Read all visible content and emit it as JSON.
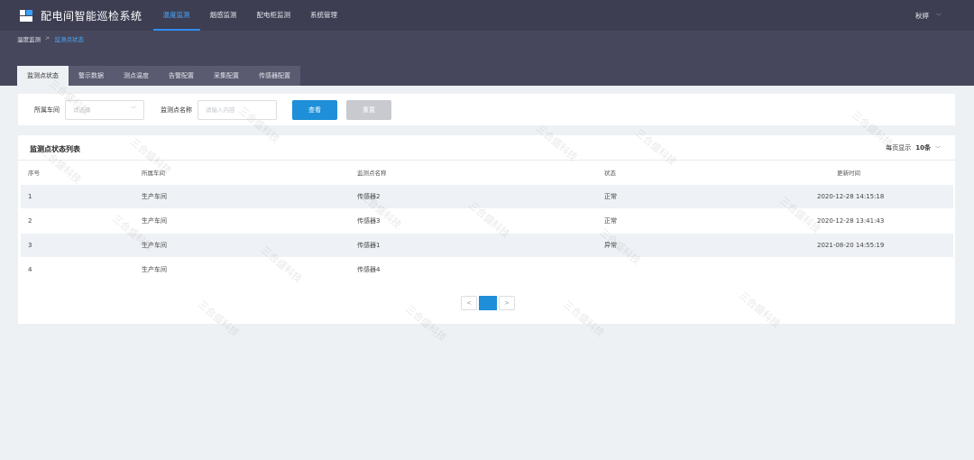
{
  "app": {
    "title": "配电间智能巡检系统",
    "user": "秋婷"
  },
  "nav": [
    {
      "label": "温度监测",
      "active": true
    },
    {
      "label": "烟感监测",
      "active": false
    },
    {
      "label": "配电柜监测",
      "active": false
    },
    {
      "label": "系统管理",
      "active": false
    }
  ],
  "breadcrumb": {
    "root": "温度监测",
    "separator": ">",
    "current": "监测点状态"
  },
  "tabs": [
    "监测点状态",
    "警示数据",
    "测点温度",
    "告警配置",
    "采集配置",
    "传感器配置"
  ],
  "filter": {
    "workshop_label": "所属车间",
    "workshop_placeholder": "请选择",
    "point_label": "监测点名称",
    "point_placeholder": "请输入内容",
    "search_button": "查看",
    "reset_button": "重置"
  },
  "table": {
    "title": "监测点状态列表",
    "page_size_label": "每页显示",
    "page_size_value": "10条",
    "columns": [
      "序号",
      "所属车间",
      "监测点名称",
      "状态",
      "更新时间"
    ],
    "rows": [
      [
        "1",
        "生产车间",
        "传感器2",
        "正常",
        "2020-12-28 14:15:18"
      ],
      [
        "2",
        "生产车间",
        "传感器3",
        "正常",
        "2020-12-28 13:41:43"
      ],
      [
        "3",
        "生产车间",
        "传感器1",
        "异常",
        "2021-08-20 14:55:19"
      ],
      [
        "4",
        "生产车间",
        "传感器4",
        "",
        ""
      ]
    ]
  },
  "pagination": {
    "prev": "<",
    "current": "1",
    "next": ">"
  },
  "watermark": "三合盛科技",
  "colors": {
    "topbar": "#3d3e52",
    "accent": "#1e8fd8"
  }
}
